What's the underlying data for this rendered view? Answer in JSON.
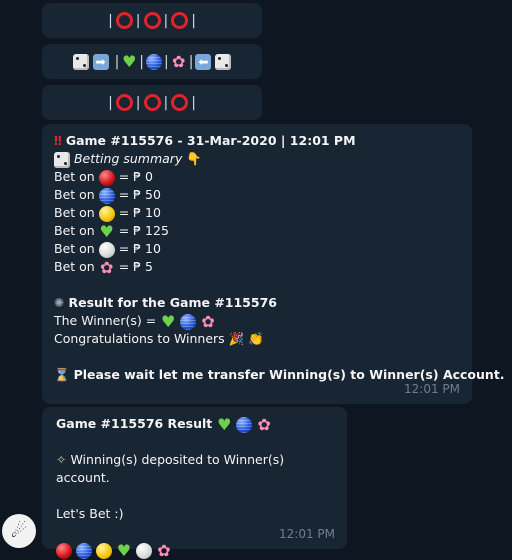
{
  "pill1": {
    "bar": "|"
  },
  "pill2": {
    "bar": "|"
  },
  "pill3": {
    "bar": "|"
  },
  "game_msg": {
    "title": "Game #115576 - 31-Mar-2020 | 12:01 PM",
    "summary": "Betting summary",
    "bets": [
      {
        "label": "Bet on",
        "value": "= ₱ 0"
      },
      {
        "label": "Bet on",
        "value": "= ₱ 50"
      },
      {
        "label": "Bet on",
        "value": "= ₱ 10"
      },
      {
        "label": "Bet on",
        "value": "= ₱ 125"
      },
      {
        "label": "Bet on",
        "value": "= ₱ 10"
      },
      {
        "label": "Bet on",
        "value": "= ₱ 5"
      }
    ],
    "result_title": "Result for the Game #115576",
    "winners_label": "The Winner(s) =",
    "congrats": "Congratulations to Winners",
    "wait": "Please wait let me transfer Winning(s) to Winner(s) Account.",
    "time": "12:01 PM"
  },
  "result_msg": {
    "title": "Game #115576 Result",
    "deposited": "Winning(s) deposited to Winner(s) account.",
    "lets_bet": "Let's Bet :)",
    "time": "12:01 PM"
  },
  "icons": {
    "dice": "dice-icon",
    "arrow_right": "arrow-right-icon",
    "arrow_left": "arrow-left-icon",
    "ring": "red-ring-icon",
    "red_ball": "red-ball-icon",
    "blue_ball": "blue-ball-icon",
    "yellow_ball": "yellow-ball-icon",
    "green_heart": "green-heart-icon",
    "white_ball": "white-ball-icon",
    "pink_flower": "pink-flower-icon"
  },
  "colors": {
    "background": "#0e1621",
    "bubble": "#182533",
    "timestamp": "#6d7f8f",
    "red": "#e0242a"
  }
}
